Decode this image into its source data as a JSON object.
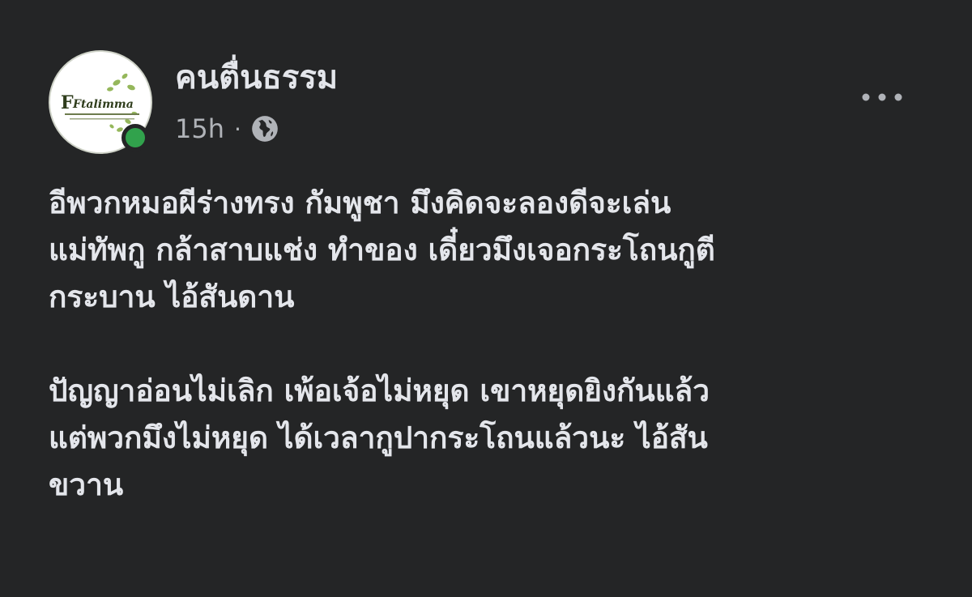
{
  "post": {
    "author": {
      "name": "คนตื่นธรรม",
      "avatar_label": "Ftalimma"
    },
    "meta": {
      "time": "15h",
      "separator": "·",
      "privacy_icon": "globe-icon"
    },
    "menu_icon": "more-horizontal-icon",
    "paragraphs": [
      "อีพวกหมอผีร่างทรง กัมพูชา มึงคิดจะลองดีจะเล่น\nแม่ทัพกู กล้าสาบแช่ง ทำของ เดี๋ยวมึงเจอกระโถนกูตี\nกระบาน ไอ้สันดาน",
      "ปัญญาอ่อนไม่เลิก เพ้อเจ้อไม่หยุด เขาหยุดยิงกันแล้ว\nแต่พวกมึงไม่หยุด ได้เวลากูปากระโถนแล้วนะ ไอ้สัน\nขวาน"
    ],
    "colors": {
      "background": "#242526",
      "primary_text": "#e4e6eb",
      "secondary_text": "#b0b3b8",
      "online": "#31a24c"
    }
  }
}
